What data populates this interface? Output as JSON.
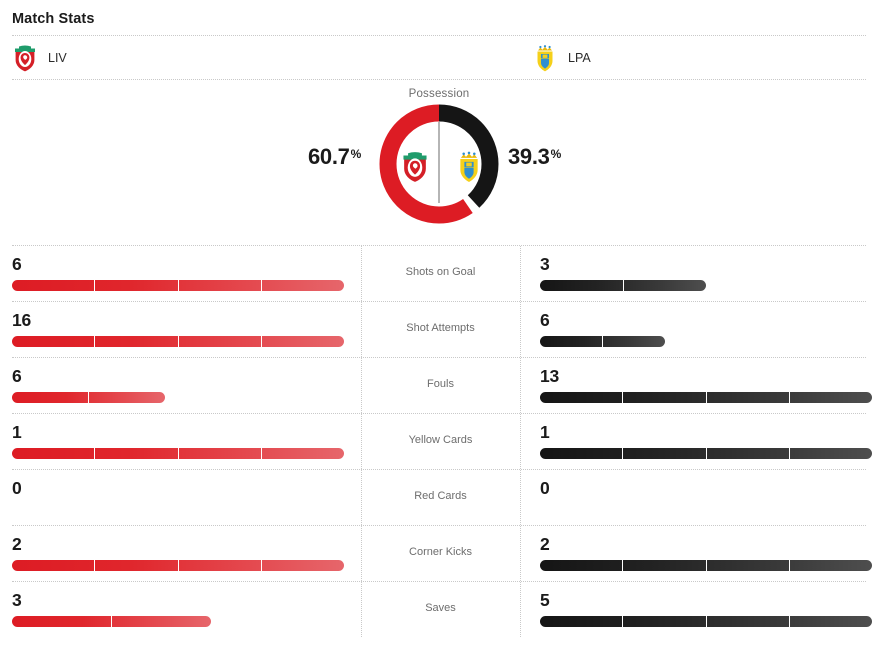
{
  "header": {
    "title": "Match Stats"
  },
  "teams": {
    "home": {
      "abbr": "LIV",
      "crest": "liverpool-crest-icon",
      "color": "#dd1c24"
    },
    "away": {
      "abbr": "LPA",
      "crest": "las-palmas-crest-icon",
      "color": "#151515"
    }
  },
  "possession": {
    "label": "Possession",
    "home_value": "60.7",
    "away_value": "39.3",
    "percent_sign": "%",
    "home_pct_num": 60.7,
    "away_pct_num": 39.3
  },
  "stats": [
    {
      "label": "Shots on Goal",
      "home": "6",
      "away": "3",
      "home_num": 6,
      "away_num": 3
    },
    {
      "label": "Shot Attempts",
      "home": "16",
      "away": "6",
      "home_num": 16,
      "away_num": 6
    },
    {
      "label": "Fouls",
      "home": "6",
      "away": "13",
      "home_num": 6,
      "away_num": 13
    },
    {
      "label": "Yellow Cards",
      "home": "1",
      "away": "1",
      "home_num": 1,
      "away_num": 1
    },
    {
      "label": "Red Cards",
      "home": "0",
      "away": "0",
      "home_num": 0,
      "away_num": 0
    },
    {
      "label": "Corner Kicks",
      "home": "2",
      "away": "2",
      "home_num": 2,
      "away_num": 2
    },
    {
      "label": "Saves",
      "home": "3",
      "away": "5",
      "home_num": 3,
      "away_num": 5
    }
  ],
  "layout": {
    "bar_max_width": 332,
    "bar_segments": 4
  },
  "colors": {
    "home_bar_start": "#dd1c24",
    "home_bar_end": "#e6666b",
    "away_bar_start": "#151515",
    "away_bar_end": "#4e4e4e",
    "label_text": "#6d6d6d",
    "value_text": "#1b1b1b",
    "rule": "#c9c9c9"
  }
}
